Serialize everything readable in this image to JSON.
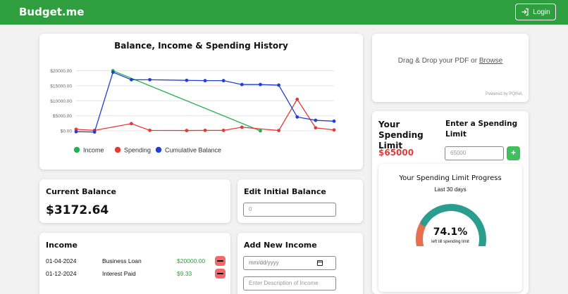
{
  "app": {
    "brand": "Budget.me",
    "login_label": "Login"
  },
  "chart_data": {
    "type": "line",
    "title": "Balance, Income & Spending History",
    "ylim": [
      0,
      22000
    ],
    "y_ticks": [
      "$0.00",
      "$5000.00",
      "$10000.00",
      "$15000.00",
      "$20000.00"
    ],
    "y_tick_values": [
      0,
      5000,
      10000,
      15000,
      20000
    ],
    "legend_placement": "bottom",
    "grid": true,
    "x_count": 14,
    "series": [
      {
        "name": "Income",
        "color": "#22b14c",
        "points": [
          [
            2,
            20000
          ],
          [
            10,
            0
          ]
        ]
      },
      {
        "name": "Spending",
        "color": "#e53935",
        "points": [
          [
            0,
            500
          ],
          [
            1,
            150
          ],
          [
            3,
            2400
          ],
          [
            4,
            150
          ],
          [
            6,
            100
          ],
          [
            7,
            150
          ],
          [
            8,
            150
          ],
          [
            9,
            1200
          ],
          [
            11,
            100
          ],
          [
            12,
            10500
          ],
          [
            13,
            1000
          ],
          [
            14,
            300
          ]
        ]
      },
      {
        "name": "Cumulative Balance",
        "color": "#1f3fd6",
        "points": [
          [
            0,
            -300
          ],
          [
            1,
            -400
          ],
          [
            2,
            19500
          ],
          [
            3,
            17000
          ],
          [
            4,
            17000
          ],
          [
            6,
            16800
          ],
          [
            7,
            16700
          ],
          [
            8,
            16700
          ],
          [
            9,
            15400
          ],
          [
            10,
            15400
          ],
          [
            11,
            15200
          ],
          [
            12,
            4600
          ],
          [
            13,
            3500
          ],
          [
            14,
            3200
          ]
        ]
      }
    ]
  },
  "upload": {
    "text": "Drag & Drop your PDF or ",
    "browse": "Browse",
    "powered": "Powered by PQINA"
  },
  "limit": {
    "title": "Your Spending Limit",
    "value": "$65000",
    "enter_label": "Enter a Spending Limit",
    "input_placeholder": "65000",
    "add_label": "+"
  },
  "progress": {
    "title": "Your Spending Limit Progress",
    "subtitle": "Last 30 days",
    "percent_text": "74.1%",
    "percent_value": 74.1,
    "caption": "left till spending limit",
    "color_remaining": "#2a9d8f",
    "color_used": "#e76f51"
  },
  "balance": {
    "title": "Current Balance",
    "value": "$3172.64"
  },
  "initial": {
    "title": "Edit Initial Balance",
    "input_placeholder": "0"
  },
  "income": {
    "title": "Income",
    "rows": [
      {
        "date": "01-04-2024",
        "description": "Business Loan",
        "amount": "$20000.00"
      },
      {
        "date": "01-12-2024",
        "description": "Interest Paid",
        "amount": "$9.33"
      }
    ]
  },
  "new_income": {
    "title": "Add New Income",
    "date_placeholder": "mm/dd/yyyy",
    "desc_placeholder": "Enter Description of Income"
  }
}
